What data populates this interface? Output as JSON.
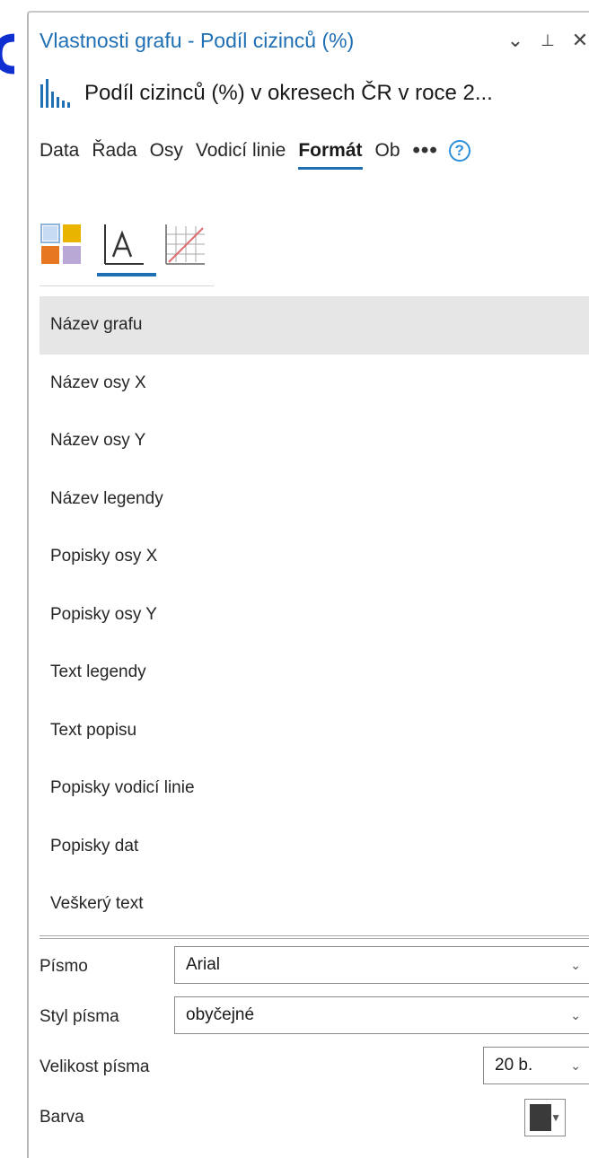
{
  "panel": {
    "title": "Vlastnosti grafu - Podíl cizinců (%)",
    "controls": {
      "menu": "⌄",
      "pin": "⊥",
      "close": "✕"
    }
  },
  "chart": {
    "name": "Podíl cizinců (%) v okresech ČR v roce 2...",
    "icon": "bar-chart-icon"
  },
  "tabs": [
    {
      "label": "Data"
    },
    {
      "label": "Řada"
    },
    {
      "label": "Osy"
    },
    {
      "label": "Vodicí linie"
    },
    {
      "label": "Formát",
      "active": true
    },
    {
      "label": "Ob"
    }
  ],
  "tab_overflow": "•••",
  "help": "?",
  "format_icons": [
    {
      "icon": "color-grid-icon"
    },
    {
      "icon": "text-format-icon",
      "active": true
    },
    {
      "icon": "grid-lines-icon"
    }
  ],
  "text_elements": [
    {
      "label": "Název grafu",
      "selected": true
    },
    {
      "label": "Název osy X"
    },
    {
      "label": "Název osy Y"
    },
    {
      "label": "Název legendy"
    },
    {
      "label": "Popisky osy X"
    },
    {
      "label": "Popisky osy Y"
    },
    {
      "label": "Text legendy"
    },
    {
      "label": "Text popisu"
    },
    {
      "label": "Popisky vodicí linie"
    },
    {
      "label": "Popisky dat"
    },
    {
      "label": "Veškerý text"
    }
  ],
  "properties": {
    "font": {
      "label": "Písmo",
      "value": "Arial"
    },
    "font_style": {
      "label": "Styl písma",
      "value": "obyčejné"
    },
    "font_size": {
      "label": "Velikost písma",
      "value": "20 b."
    },
    "color": {
      "label": "Barva",
      "value": "#3a3a3a"
    }
  },
  "colors": {
    "accent": "#1f6fb4",
    "marker": "#0f2fd1",
    "selection": "#e6e6e6"
  }
}
